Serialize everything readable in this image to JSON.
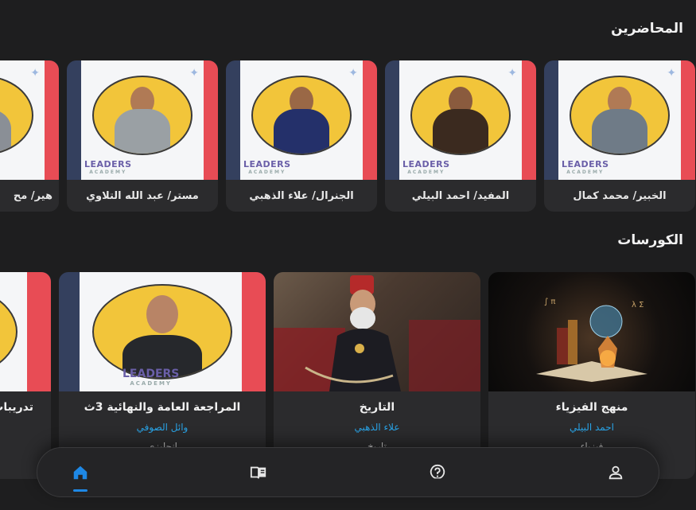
{
  "sections": {
    "lecturers_title": "المحاضرين",
    "courses_title": "الكورسات"
  },
  "lecturers": [
    {
      "name": "الخبير/ محمد كمال",
      "shirt": "#6f7b87"
    },
    {
      "name": "المفيد/ احمد البيلي",
      "shirt": "#3b2a1f"
    },
    {
      "name": "الجنرال/ علاء الذهبي",
      "shirt": "#24306a"
    },
    {
      "name": "مستر/ عبد الله التلاوي",
      "shirt": "#9aa0a4"
    },
    {
      "name": "هير/ مح",
      "shirt": "#8a8f96"
    }
  ],
  "courses": [
    {
      "title": "منهج الفيزياء",
      "teacher": "احمد البيلي",
      "extra": "فيزياء"
    },
    {
      "title": "التاريخ",
      "teacher": "علاء الذهبي",
      "extra": "تاريخ"
    },
    {
      "title": "المراجعة العامة والنهائية 3ث",
      "teacher": "وائل الصوفي",
      "extra": "انجليزي"
    },
    {
      "title": "تدريبات",
      "teacher": "",
      "extra": ""
    }
  ],
  "brand": {
    "logo_text": "LEADERS",
    "logo_sub": "ACADEMY"
  },
  "nav": {
    "items": [
      "profile-icon",
      "question-icon",
      "book-icon",
      "home-icon"
    ],
    "active": "home-icon",
    "active_color": "#1e88e5",
    "icon_color": "#e6e6e6"
  }
}
